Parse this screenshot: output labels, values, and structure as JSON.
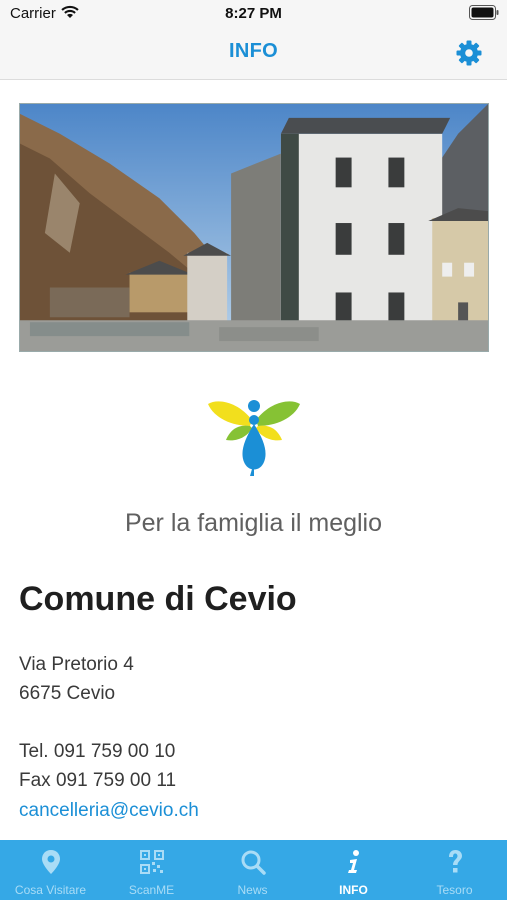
{
  "status": {
    "carrier": "Carrier",
    "time": "8:27 PM"
  },
  "nav": {
    "title": "INFO"
  },
  "content": {
    "tagline": "Per la famiglia il meglio",
    "org_name": "Comune di Cevio",
    "address_line1": "Via Pretorio 4",
    "address_line2": "6675 Cevio",
    "phone": "Tel. 091 759 00 10",
    "fax": "Fax 091 759 00 11",
    "email": "cancelleria@cevio.ch"
  },
  "tabs": [
    {
      "label": "Cosa Visitare",
      "icon": "map-pin-icon"
    },
    {
      "label": "ScanME",
      "icon": "qr-code-icon"
    },
    {
      "label": "News",
      "icon": "search-icon"
    },
    {
      "label": "INFO",
      "icon": "info-icon",
      "active": true
    },
    {
      "label": "Tesoro",
      "icon": "question-icon"
    }
  ],
  "colors": {
    "accent": "#1b8fd6",
    "tab_bar": "#35a8e6",
    "tab_inactive": "#a9dcf6"
  }
}
